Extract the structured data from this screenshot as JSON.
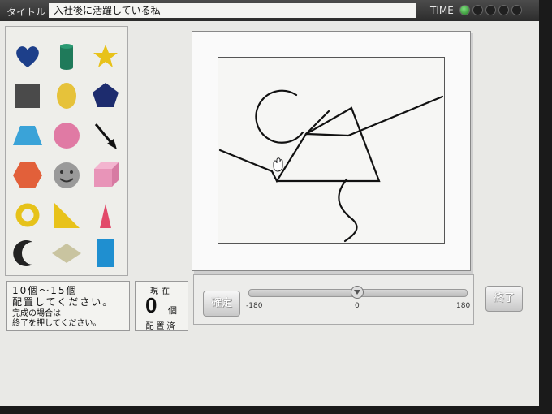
{
  "titlebar": {
    "label": "タイトル",
    "title": "入社後に活躍している私",
    "time_label": "TIME",
    "timer_dots_total": 5,
    "timer_dots_on": 1
  },
  "palette": {
    "shapes": [
      {
        "name": "heart",
        "color": "#1d3f8a"
      },
      {
        "name": "cylinder",
        "color": "#1f7a5a"
      },
      {
        "name": "star",
        "color": "#e8c21a"
      },
      {
        "name": "square",
        "color": "#4a4a4a"
      },
      {
        "name": "ellipse",
        "color": "#e6c23a"
      },
      {
        "name": "pentagon",
        "color": "#1d2c6e"
      },
      {
        "name": "trapezoid",
        "color": "#3aa3d8"
      },
      {
        "name": "circle",
        "color": "#e07aa4"
      },
      {
        "name": "arrow",
        "color": "#111111"
      },
      {
        "name": "hexagon",
        "color": "#e2603a"
      },
      {
        "name": "smiley",
        "color": "#9a9a9a"
      },
      {
        "name": "cube",
        "color": "#e894b8"
      },
      {
        "name": "ring",
        "color": "#e6c21a"
      },
      {
        "name": "right-triangle",
        "color": "#e8c21a"
      },
      {
        "name": "triangle",
        "color": "#e24a6a"
      },
      {
        "name": "crescent",
        "color": "#222222"
      },
      {
        "name": "diamond",
        "color": "#c9c4a0"
      },
      {
        "name": "rectangle",
        "color": "#1f8fd0"
      }
    ]
  },
  "instructions": {
    "line1": "10個～15個",
    "line2": "配置してください。",
    "line3": "完成の場合は",
    "line4": "終了を押してください。"
  },
  "counter": {
    "label": "現在",
    "value": "0",
    "unit": "個",
    "done_label": "配置済"
  },
  "controls": {
    "confirm_label": "確定",
    "finish_label": "終了",
    "rotation": {
      "min": -180,
      "max": 180,
      "value": 0,
      "min_label": "-180",
      "mid_label": "0",
      "max_label": "180"
    }
  }
}
